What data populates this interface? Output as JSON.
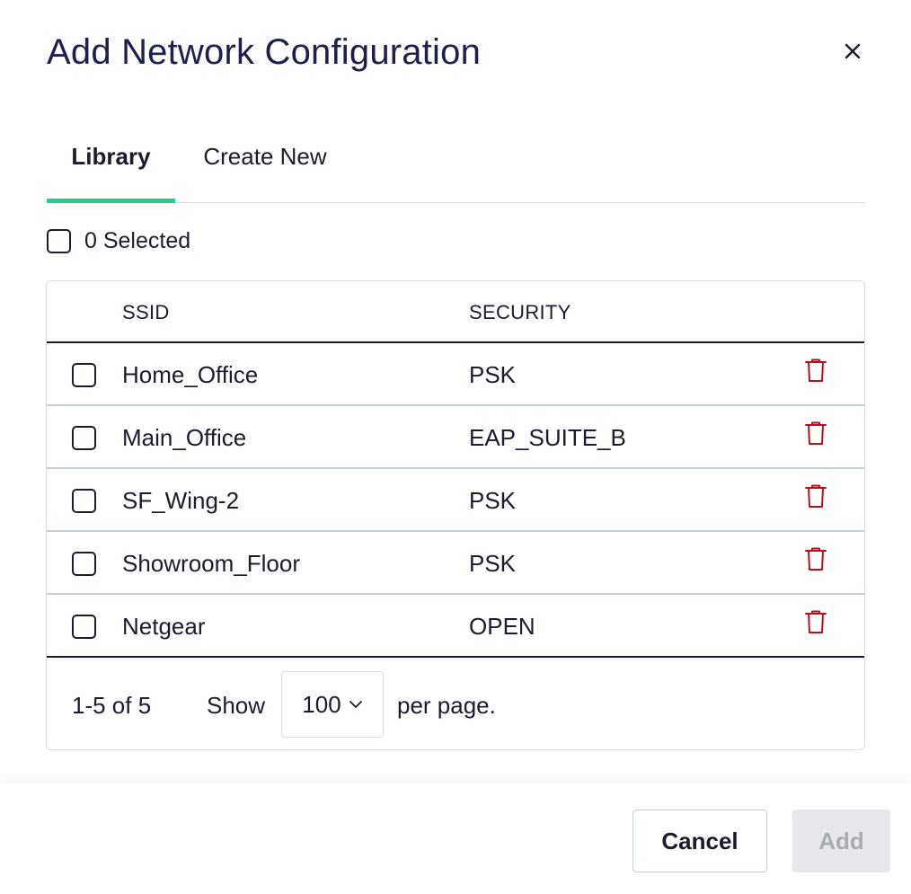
{
  "dialog": {
    "title": "Add Network Configuration",
    "close_icon": "close-icon"
  },
  "tabs": [
    {
      "label": "Library",
      "active": true
    },
    {
      "label": "Create New",
      "active": false
    }
  ],
  "accent_color": "#1fcf8c",
  "delete_color": "#b3141b",
  "selection": {
    "label": "0 Selected",
    "checked": false
  },
  "table": {
    "columns": [
      "SSID",
      "SECURITY"
    ],
    "rows": [
      {
        "ssid": "Home_Office",
        "security": "PSK",
        "checked": false
      },
      {
        "ssid": "Main_Office",
        "security": "EAP_SUITE_B",
        "checked": false
      },
      {
        "ssid": "SF_Wing-2",
        "security": "PSK",
        "checked": false
      },
      {
        "ssid": "Showroom_Floor",
        "security": "PSK",
        "checked": false
      },
      {
        "ssid": "Netgear",
        "security": "OPEN",
        "checked": false
      }
    ],
    "row_action_icon": "trash-icon"
  },
  "pagination": {
    "range": "1-5 of 5",
    "show_label": "Show",
    "page_size": "100",
    "per_page_label": "per page."
  },
  "footer": {
    "cancel_label": "Cancel",
    "add_label": "Add",
    "add_disabled": true
  }
}
